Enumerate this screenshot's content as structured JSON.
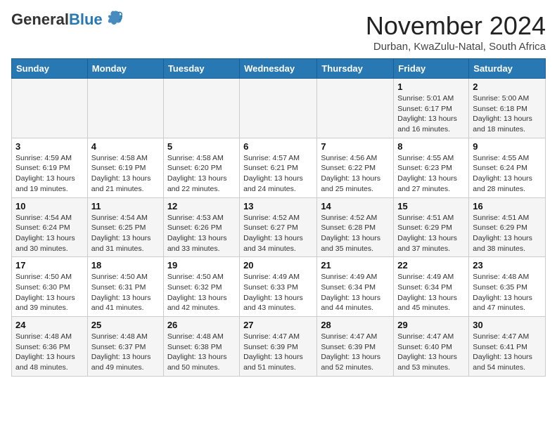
{
  "header": {
    "logo_general": "General",
    "logo_blue": "Blue",
    "title": "November 2024",
    "location": "Durban, KwaZulu-Natal, South Africa"
  },
  "days_of_week": [
    "Sunday",
    "Monday",
    "Tuesday",
    "Wednesday",
    "Thursday",
    "Friday",
    "Saturday"
  ],
  "weeks": [
    [
      {
        "day": "",
        "info": ""
      },
      {
        "day": "",
        "info": ""
      },
      {
        "day": "",
        "info": ""
      },
      {
        "day": "",
        "info": ""
      },
      {
        "day": "",
        "info": ""
      },
      {
        "day": "1",
        "info": "Sunrise: 5:01 AM\nSunset: 6:17 PM\nDaylight: 13 hours and 16 minutes."
      },
      {
        "day": "2",
        "info": "Sunrise: 5:00 AM\nSunset: 6:18 PM\nDaylight: 13 hours and 18 minutes."
      }
    ],
    [
      {
        "day": "3",
        "info": "Sunrise: 4:59 AM\nSunset: 6:19 PM\nDaylight: 13 hours and 19 minutes."
      },
      {
        "day": "4",
        "info": "Sunrise: 4:58 AM\nSunset: 6:19 PM\nDaylight: 13 hours and 21 minutes."
      },
      {
        "day": "5",
        "info": "Sunrise: 4:58 AM\nSunset: 6:20 PM\nDaylight: 13 hours and 22 minutes."
      },
      {
        "day": "6",
        "info": "Sunrise: 4:57 AM\nSunset: 6:21 PM\nDaylight: 13 hours and 24 minutes."
      },
      {
        "day": "7",
        "info": "Sunrise: 4:56 AM\nSunset: 6:22 PM\nDaylight: 13 hours and 25 minutes."
      },
      {
        "day": "8",
        "info": "Sunrise: 4:55 AM\nSunset: 6:23 PM\nDaylight: 13 hours and 27 minutes."
      },
      {
        "day": "9",
        "info": "Sunrise: 4:55 AM\nSunset: 6:24 PM\nDaylight: 13 hours and 28 minutes."
      }
    ],
    [
      {
        "day": "10",
        "info": "Sunrise: 4:54 AM\nSunset: 6:24 PM\nDaylight: 13 hours and 30 minutes."
      },
      {
        "day": "11",
        "info": "Sunrise: 4:54 AM\nSunset: 6:25 PM\nDaylight: 13 hours and 31 minutes."
      },
      {
        "day": "12",
        "info": "Sunrise: 4:53 AM\nSunset: 6:26 PM\nDaylight: 13 hours and 33 minutes."
      },
      {
        "day": "13",
        "info": "Sunrise: 4:52 AM\nSunset: 6:27 PM\nDaylight: 13 hours and 34 minutes."
      },
      {
        "day": "14",
        "info": "Sunrise: 4:52 AM\nSunset: 6:28 PM\nDaylight: 13 hours and 35 minutes."
      },
      {
        "day": "15",
        "info": "Sunrise: 4:51 AM\nSunset: 6:29 PM\nDaylight: 13 hours and 37 minutes."
      },
      {
        "day": "16",
        "info": "Sunrise: 4:51 AM\nSunset: 6:29 PM\nDaylight: 13 hours and 38 minutes."
      }
    ],
    [
      {
        "day": "17",
        "info": "Sunrise: 4:50 AM\nSunset: 6:30 PM\nDaylight: 13 hours and 39 minutes."
      },
      {
        "day": "18",
        "info": "Sunrise: 4:50 AM\nSunset: 6:31 PM\nDaylight: 13 hours and 41 minutes."
      },
      {
        "day": "19",
        "info": "Sunrise: 4:50 AM\nSunset: 6:32 PM\nDaylight: 13 hours and 42 minutes."
      },
      {
        "day": "20",
        "info": "Sunrise: 4:49 AM\nSunset: 6:33 PM\nDaylight: 13 hours and 43 minutes."
      },
      {
        "day": "21",
        "info": "Sunrise: 4:49 AM\nSunset: 6:34 PM\nDaylight: 13 hours and 44 minutes."
      },
      {
        "day": "22",
        "info": "Sunrise: 4:49 AM\nSunset: 6:34 PM\nDaylight: 13 hours and 45 minutes."
      },
      {
        "day": "23",
        "info": "Sunrise: 4:48 AM\nSunset: 6:35 PM\nDaylight: 13 hours and 47 minutes."
      }
    ],
    [
      {
        "day": "24",
        "info": "Sunrise: 4:48 AM\nSunset: 6:36 PM\nDaylight: 13 hours and 48 minutes."
      },
      {
        "day": "25",
        "info": "Sunrise: 4:48 AM\nSunset: 6:37 PM\nDaylight: 13 hours and 49 minutes."
      },
      {
        "day": "26",
        "info": "Sunrise: 4:48 AM\nSunset: 6:38 PM\nDaylight: 13 hours and 50 minutes."
      },
      {
        "day": "27",
        "info": "Sunrise: 4:47 AM\nSunset: 6:39 PM\nDaylight: 13 hours and 51 minutes."
      },
      {
        "day": "28",
        "info": "Sunrise: 4:47 AM\nSunset: 6:39 PM\nDaylight: 13 hours and 52 minutes."
      },
      {
        "day": "29",
        "info": "Sunrise: 4:47 AM\nSunset: 6:40 PM\nDaylight: 13 hours and 53 minutes."
      },
      {
        "day": "30",
        "info": "Sunrise: 4:47 AM\nSunset: 6:41 PM\nDaylight: 13 hours and 54 minutes."
      }
    ]
  ]
}
